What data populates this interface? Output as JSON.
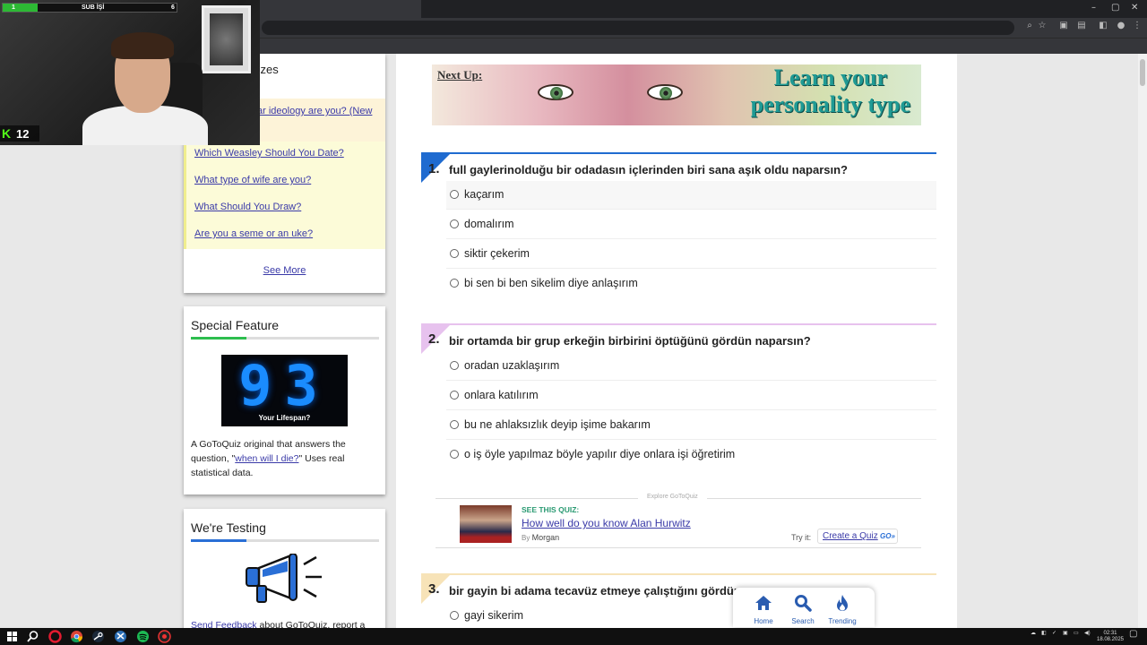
{
  "browser": {
    "window_controls": [
      "–",
      "▢",
      "✕"
    ]
  },
  "stream_overlay": {
    "goal_left": "1",
    "goal_label": "SUB İŞİ",
    "goal_right": "6",
    "goal_fraction": 0.2,
    "viewer_count": "12",
    "platform_icon": "kick-logo"
  },
  "sidebar": {
    "quizzes_title_partial": "zzes",
    "featured_link_partial": "ar ideology are you? (New",
    "links": [
      "Which Weasley Should You Date?",
      "What type of wife are you?",
      "What Should You Draw?",
      "Are you a seme or an uke?"
    ],
    "see_more": "See More",
    "special_feature": {
      "title": "Special Feature",
      "image_number": "93",
      "image_caption": "Your Lifespan?",
      "text_before": "A GoToQuiz original that answers the question, \"",
      "link": "when will I die?",
      "text_after": "\" Uses real statistical data."
    },
    "testing": {
      "title": "We're Testing",
      "link": "Send Feedback",
      "text_after": " about GoToQuiz, report a"
    }
  },
  "banner": {
    "next_up": "Next Up:",
    "line1": "Learn your",
    "line2": "personality type"
  },
  "questions": [
    {
      "number": "1.",
      "text": "full gaylerinolduğu bir odadasın içlerinden biri sana aşık oldu naparsın?",
      "color": "#1f6bd0",
      "options": [
        "kaçarım",
        "domalırım",
        "siktir çekerim",
        "bi sen bi ben sikelim diye anlaşırım"
      ]
    },
    {
      "number": "2.",
      "text": "bir ortamda bir grup erkeğin birbirini öptüğünü gördün naparsın?",
      "color": "#e7c2ee",
      "options": [
        "oradan uzaklaşırım",
        "onlara katılırım",
        "bu ne ahlaksızlık deyip işime bakarım",
        "o iş öyle yapılmaz böyle yapılır diye onlara işi öğretirim"
      ]
    },
    {
      "number": "3.",
      "text": "bir gayin bi adama tecavüz etmeye çalıştığını gördün",
      "color": "#f7e3b8",
      "options": [
        "gayi sikerim"
      ]
    }
  ],
  "explore": {
    "tag": "Explore GoToQuiz",
    "see_this": "SEE THIS QUIZ:",
    "title": "How well do you know Alan Hurwitz",
    "by_label": "By",
    "by_name": "Morgan",
    "try_it": "Try it:",
    "create": "Create a Quiz",
    "create_badge": "GO»"
  },
  "bottom_nav": [
    {
      "label": "Home",
      "icon": "home-icon"
    },
    {
      "label": "Search",
      "icon": "search-icon"
    },
    {
      "label": "Trending",
      "icon": "flame-icon"
    }
  ],
  "taskbar": {
    "time": "02:31",
    "date": "18.08.2025"
  }
}
